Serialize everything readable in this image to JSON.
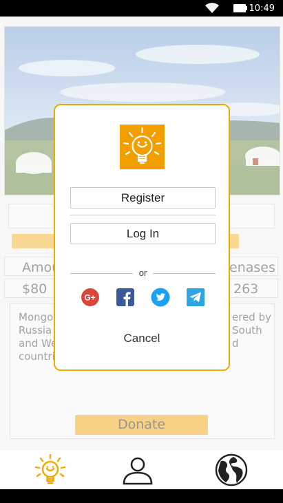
{
  "status_bar": {
    "time": "10:49",
    "icons": [
      "wifi-icon",
      "battery-icon"
    ]
  },
  "background": {
    "amount_label_partial": "Amou",
    "amount_value_partial": "$80",
    "right_label_partial": "enases",
    "right_value_partial": "263",
    "description_lines_left": [
      "Mongo",
      "Russia",
      "and We",
      "countri"
    ],
    "description_lines_right": [
      "ered by",
      "South",
      "d"
    ],
    "donate_label": "Donate"
  },
  "modal": {
    "logo_icon": "lightbulb-smile-icon",
    "register_label": "Register",
    "login_label": "Log In",
    "or_label": "or",
    "social": [
      "google-plus-icon",
      "facebook-icon",
      "twitter-icon",
      "telegram-icon"
    ],
    "cancel_label": "Cancel"
  },
  "bottom_nav": {
    "items": [
      "lightbulb-icon",
      "profile-icon",
      "globe-icon"
    ]
  },
  "colors": {
    "accent": "#f2a900",
    "logo_bg": "#f29e00",
    "google": "#d9473c",
    "facebook": "#3b5998",
    "twitter": "#1da1f2",
    "telegram": "#2ca5e0"
  }
}
